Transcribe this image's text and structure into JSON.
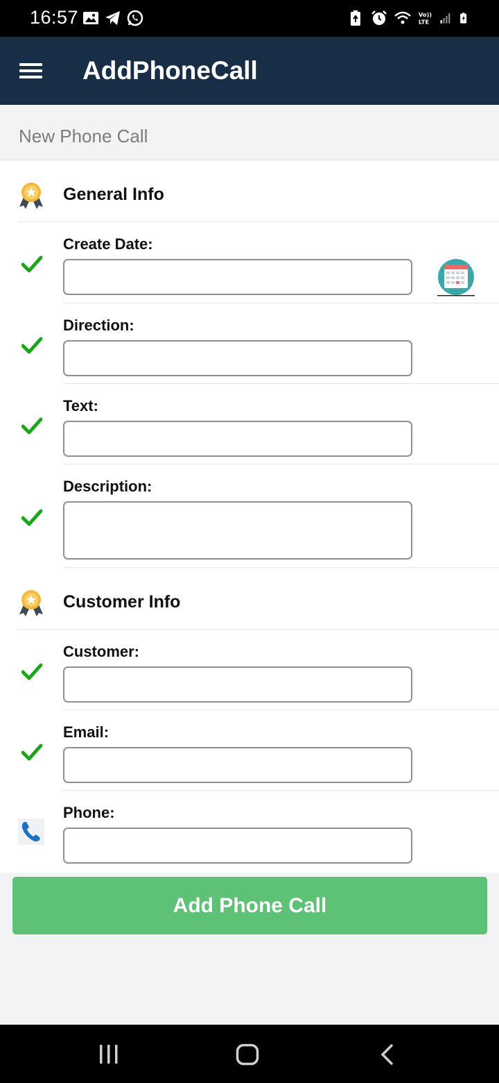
{
  "status_bar": {
    "time": "16:57",
    "left_icons": [
      "gallery-icon",
      "telegram-icon",
      "whatsapp-icon"
    ],
    "right_icons": [
      "battery-saver-icon",
      "alarm-icon",
      "wifi-icon",
      "volte-lte-icon",
      "signal-icon",
      "battery-charging-icon"
    ],
    "volte_text": "Vo)) LTE"
  },
  "app_bar": {
    "title": "AddPhoneCall",
    "menu_icon": "hamburger-menu-icon",
    "background": "#172e46"
  },
  "subheader": {
    "label": "New Phone Call"
  },
  "sections": [
    {
      "title": "General Info",
      "icon": "award-medal-icon",
      "fields": [
        {
          "label": "Create Date:",
          "value": "",
          "icon": "checkmark-icon",
          "type": "input"
        },
        {
          "label": "Direction:",
          "value": "",
          "icon": "checkmark-icon",
          "type": "input"
        },
        {
          "label": "Text:",
          "value": "",
          "icon": "checkmark-icon",
          "type": "input"
        },
        {
          "label": "Description:",
          "value": "",
          "icon": "checkmark-icon",
          "type": "textarea"
        }
      ]
    },
    {
      "title": "Customer Info",
      "icon": "award-medal-icon",
      "fields": [
        {
          "label": "Customer:",
          "value": "",
          "icon": "checkmark-icon",
          "type": "input"
        },
        {
          "label": "Email:",
          "value": "",
          "icon": "checkmark-icon",
          "type": "input"
        },
        {
          "label": "Phone:",
          "value": "",
          "icon": "phone-icon",
          "type": "input"
        }
      ]
    }
  ],
  "date_picker_icon": "calendar-icon",
  "submit": {
    "label": "Add Phone Call",
    "color": "#5ec276"
  },
  "nav_bar": {
    "buttons": [
      "recent-apps-icon",
      "home-icon",
      "back-icon"
    ]
  }
}
